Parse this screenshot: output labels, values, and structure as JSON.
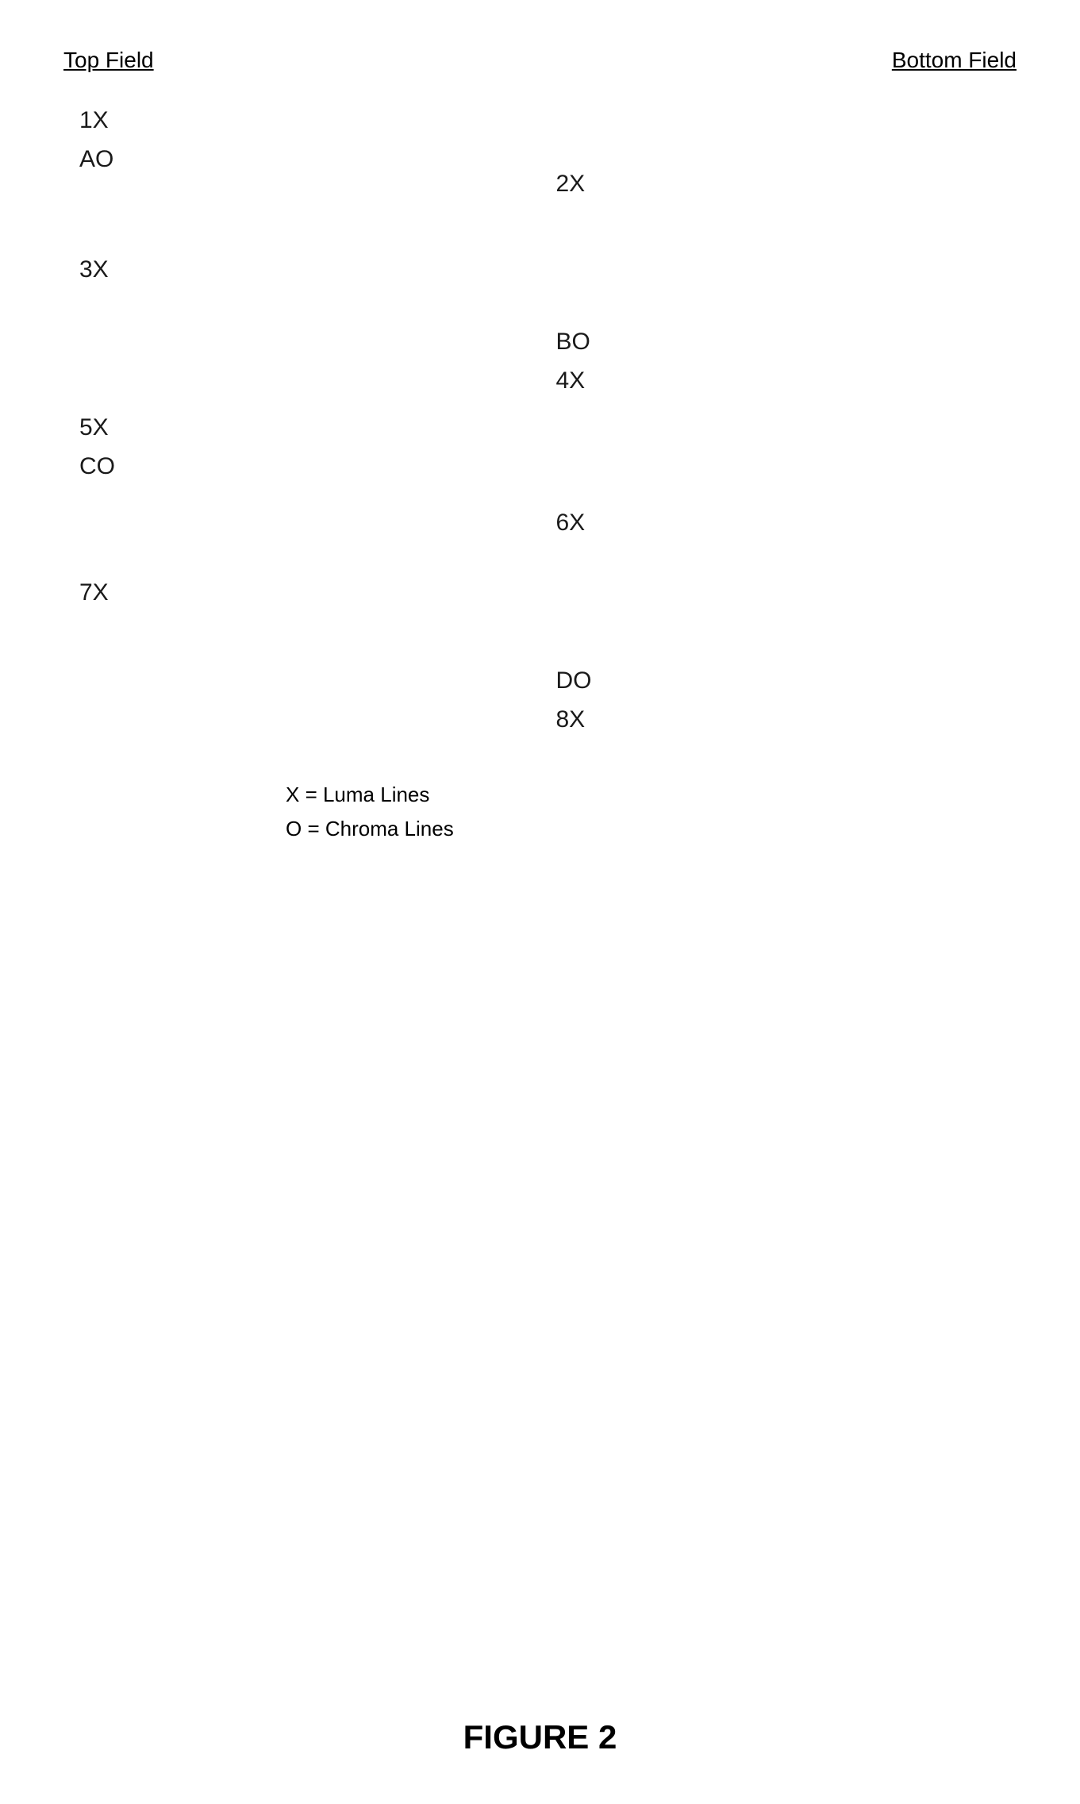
{
  "header": {
    "top_field_label": "Top Field",
    "bottom_field_label": "Bottom Field"
  },
  "left_column": {
    "items": [
      {
        "id": "1x",
        "label": "1X",
        "top_gap": 0
      },
      {
        "id": "a0",
        "label": "AO",
        "top_gap": 10
      },
      {
        "id": "3x",
        "label": "3X",
        "top_gap": 110
      },
      {
        "id": "5x",
        "label": "5X",
        "top_gap": 200
      },
      {
        "id": "c0",
        "label": "CO",
        "top_gap": 10
      },
      {
        "id": "7x",
        "label": "7X",
        "top_gap": 140
      }
    ]
  },
  "right_column": {
    "items": [
      {
        "id": "2x",
        "label": "2X",
        "top_gap": 80
      },
      {
        "id": "b0",
        "label": "BO",
        "top_gap": 200
      },
      {
        "id": "4x",
        "label": "4X",
        "top_gap": 10
      },
      {
        "id": "6x",
        "label": "6X",
        "top_gap": 170
      },
      {
        "id": "d0",
        "label": "DO",
        "top_gap": 200
      },
      {
        "id": "8x",
        "label": "8X",
        "top_gap": 10
      }
    ]
  },
  "legend": {
    "items": [
      {
        "id": "x-legend",
        "label": "X = Luma Lines"
      },
      {
        "id": "o-legend",
        "label": "O = Chroma Lines"
      }
    ]
  },
  "figure": {
    "caption": "FIGURE 2"
  }
}
